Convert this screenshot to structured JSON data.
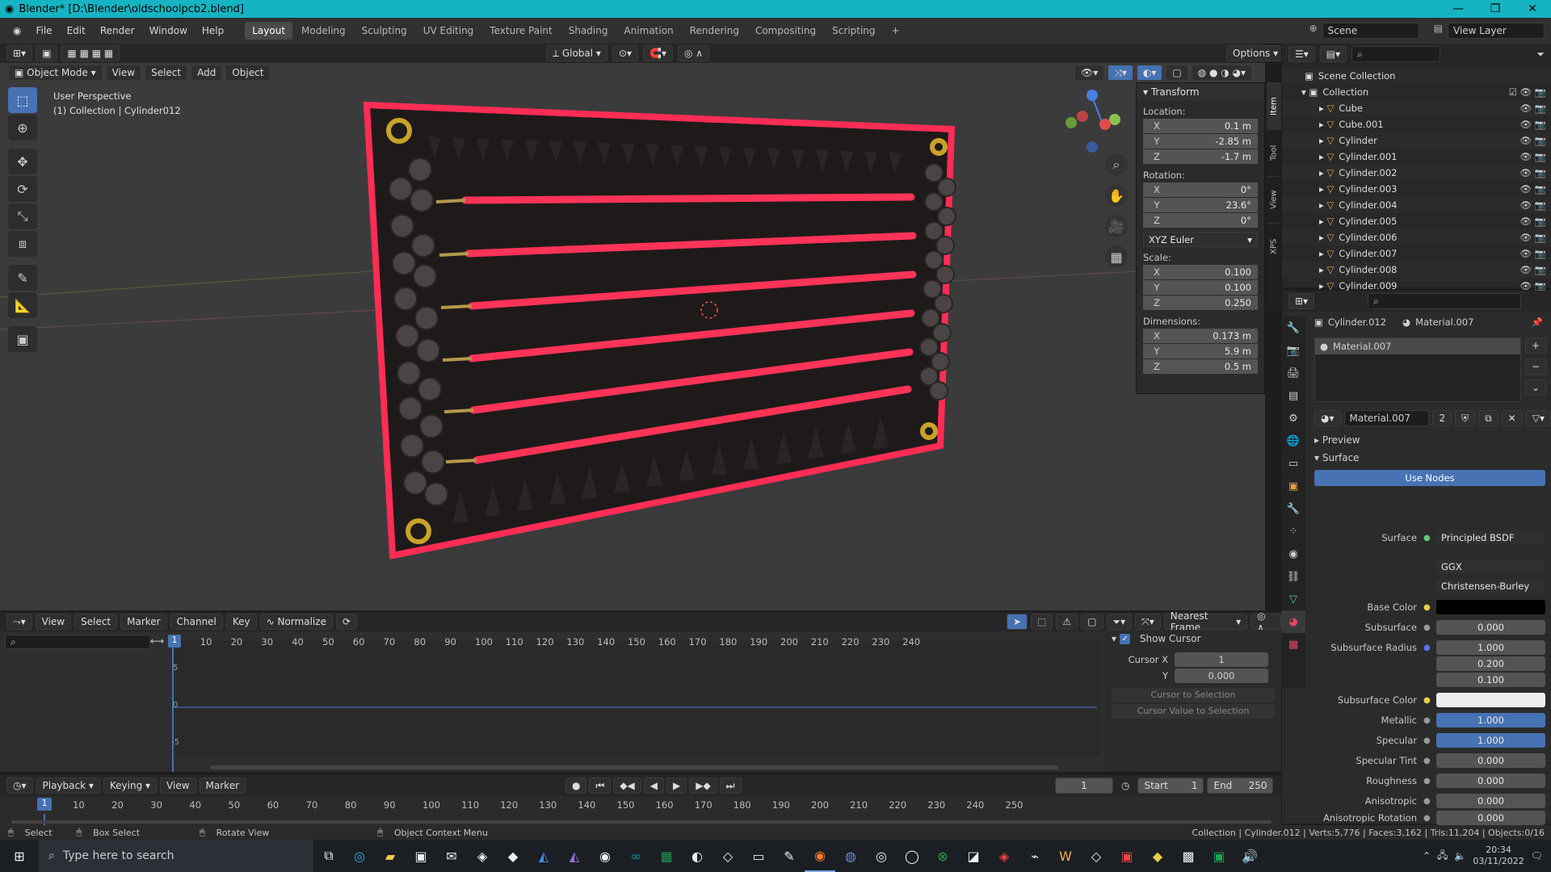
{
  "window": {
    "title": "Blender* [D:\\Blender\\oldschoolpcb2.blend]"
  },
  "menu": {
    "file": "File",
    "edit": "Edit",
    "render": "Render",
    "window": "Window",
    "help": "Help"
  },
  "workspaces": [
    "Layout",
    "Modeling",
    "Sculpting",
    "UV Editing",
    "Texture Paint",
    "Shading",
    "Animation",
    "Rendering",
    "Compositing",
    "Scripting"
  ],
  "workspace_add": "+",
  "scene": {
    "scene": "Scene",
    "view_layer": "View Layer"
  },
  "vp_header": {
    "mode": "Object Mode",
    "view": "View",
    "select": "Select",
    "add": "Add",
    "object": "Object",
    "orientation": "Global",
    "options": "Options"
  },
  "viewport": {
    "perspective": "User Perspective",
    "collection_info": "(1) Collection | Cylinder012"
  },
  "side_tabs": [
    "Item",
    "Tool",
    "View",
    "XPS"
  ],
  "transform": {
    "title": "Transform",
    "location_label": "Location:",
    "location": [
      {
        "axis": "X",
        "value": "0.1 m"
      },
      {
        "axis": "Y",
        "value": "-2.85 m"
      },
      {
        "axis": "Z",
        "value": "-1.7 m"
      }
    ],
    "rotation_label": "Rotation:",
    "rotation": [
      {
        "axis": "X",
        "value": "0°"
      },
      {
        "axis": "Y",
        "value": "23.6°"
      },
      {
        "axis": "Z",
        "value": "0°"
      }
    ],
    "rotation_mode": "XYZ Euler",
    "scale_label": "Scale:",
    "scale": [
      {
        "axis": "X",
        "value": "0.100"
      },
      {
        "axis": "Y",
        "value": "0.100"
      },
      {
        "axis": "Z",
        "value": "0.250"
      }
    ],
    "dimensions_label": "Dimensions:",
    "dimensions": [
      {
        "axis": "X",
        "value": "0.173 m"
      },
      {
        "axis": "Y",
        "value": "5.9 m"
      },
      {
        "axis": "Z",
        "value": "0.5 m"
      }
    ]
  },
  "outliner": {
    "root": "Scene Collection",
    "collection": "Collection",
    "items": [
      "Cube",
      "Cube.001",
      "Cylinder",
      "Cylinder.001",
      "Cylinder.002",
      "Cylinder.003",
      "Cylinder.004",
      "Cylinder.005",
      "Cylinder.006",
      "Cylinder.007",
      "Cylinder.008",
      "Cylinder.009"
    ]
  },
  "properties": {
    "object": "Cylinder.012",
    "material": "Material.007",
    "slot": "Material.007",
    "material_field": "Material.007",
    "users": "2",
    "preview": "Preview",
    "surface_section": "Surface",
    "use_nodes": "Use Nodes",
    "surface_label": "Surface",
    "surface_shader": "Principled BSDF",
    "distribution": "GGX",
    "subsurface_method": "Christensen-Burley",
    "rows": [
      {
        "label": "Base Color",
        "value": "",
        "kind": "color-black"
      },
      {
        "label": "Subsurface",
        "value": "0.000",
        "kind": "num"
      },
      {
        "label": "Subsurface Radius",
        "value": "1.000",
        "kind": "num"
      },
      {
        "label": "",
        "value": "0.200",
        "kind": "num"
      },
      {
        "label": "",
        "value": "0.100",
        "kind": "num"
      },
      {
        "label": "Subsurface Color",
        "value": "",
        "kind": "color-white"
      },
      {
        "label": "Metallic",
        "value": "1.000",
        "kind": "blue"
      },
      {
        "label": "Specular",
        "value": "1.000",
        "kind": "blue"
      },
      {
        "label": "Specular Tint",
        "value": "0.000",
        "kind": "num"
      },
      {
        "label": "Roughness",
        "value": "0.000",
        "kind": "num"
      },
      {
        "label": "Anisotropic",
        "value": "0.000",
        "kind": "num"
      },
      {
        "label": "Anisotropic Rotation",
        "value": "0.000",
        "kind": "num"
      }
    ]
  },
  "graph": {
    "view": "View",
    "select": "Select",
    "marker": "Marker",
    "channel": "Channel",
    "key": "Key",
    "normalize": "Normalize",
    "snap": "Nearest Frame",
    "ticks": [
      "1",
      "10",
      "20",
      "30",
      "40",
      "50",
      "60",
      "70",
      "80",
      "90",
      "100",
      "110",
      "120",
      "130",
      "140",
      "150",
      "160",
      "170",
      "180",
      "190",
      "200",
      "210",
      "220",
      "230",
      "240"
    ],
    "yticks": [
      "5",
      "0",
      "-5"
    ],
    "show_cursor": "Show Cursor",
    "cursor_x_label": "Cursor X",
    "cursor_x": "1",
    "cursor_y_label": "Y",
    "cursor_y": "0.000",
    "cursor_to_selection": "Cursor to Selection",
    "cursor_value_to_selection": "Cursor Value to Selection"
  },
  "timeline": {
    "playback": "Playback",
    "keying": "Keying",
    "view": "View",
    "marker": "Marker",
    "current_frame": "1",
    "start_label": "Start",
    "start": "1",
    "end_label": "End",
    "end": "250",
    "ticks": [
      "1",
      "10",
      "20",
      "30",
      "40",
      "50",
      "60",
      "70",
      "80",
      "90",
      "100",
      "110",
      "120",
      "130",
      "140",
      "150",
      "160",
      "170",
      "180",
      "190",
      "200",
      "210",
      "220",
      "230",
      "240",
      "250"
    ]
  },
  "status": {
    "select": "Select",
    "box_select": "Box Select",
    "rotate_view": "Rotate View",
    "context_menu": "Object Context Menu",
    "stats": "Collection | Cylinder.012 | Verts:5,776 | Faces:3,162 | Tris:11,204 | Objects:0/16"
  },
  "taskbar": {
    "search_placeholder": "Type here to search",
    "time": "20:34",
    "date": "03/11/2022"
  },
  "colors": {
    "accent": "#4772b3",
    "titlebar": "#15b4c2",
    "trace": "#ff2d55",
    "board": "#1f1a1a"
  }
}
